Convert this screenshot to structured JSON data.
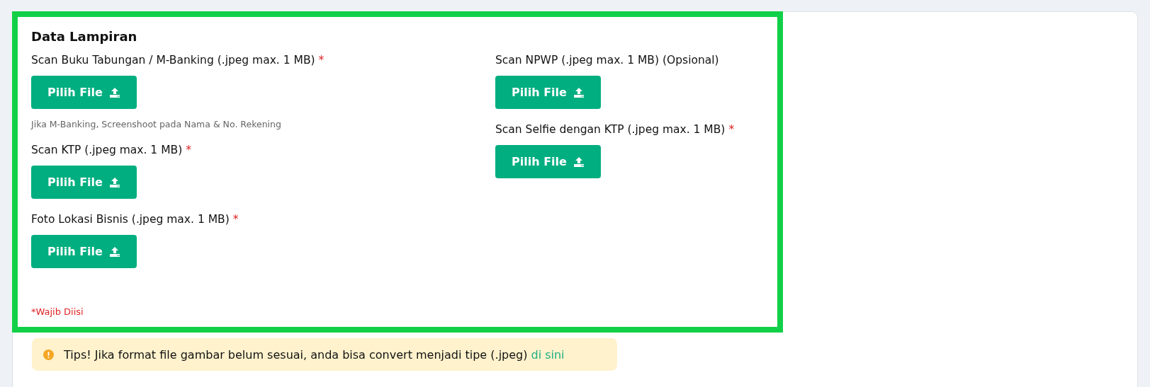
{
  "section": {
    "title": "Data Lampiran",
    "columns": [
      {
        "fields": [
          {
            "label": "Scan Buku Tabungan / M-Banking (.jpeg max. 1 MB)",
            "required_mark": "*",
            "button": "Pilih File",
            "hint": "Jika M-Banking, Screenshoot pada Nama & No. Rekening"
          },
          {
            "label": "Scan KTP (.jpeg max. 1 MB)",
            "required_mark": "*",
            "button": "Pilih File"
          },
          {
            "label": "Foto Lokasi Bisnis (.jpeg max. 1 MB)",
            "required_mark": "*",
            "button": "Pilih File"
          }
        ]
      },
      {
        "fields": [
          {
            "label": "Scan NPWP (.jpeg max. 1 MB) (Opsional)",
            "button": "Pilih File"
          },
          {
            "label": "Scan Selfie dengan KTP (.jpeg max. 1 MB)",
            "required_mark": "*",
            "button": "Pilih File"
          }
        ]
      }
    ],
    "footnote": "*Wajib Diisi"
  },
  "tip": {
    "text": "Tips! Jika format file gambar belum sesuai, anda bisa convert menjadi tipe (.jpeg)",
    "link": "di sini"
  }
}
